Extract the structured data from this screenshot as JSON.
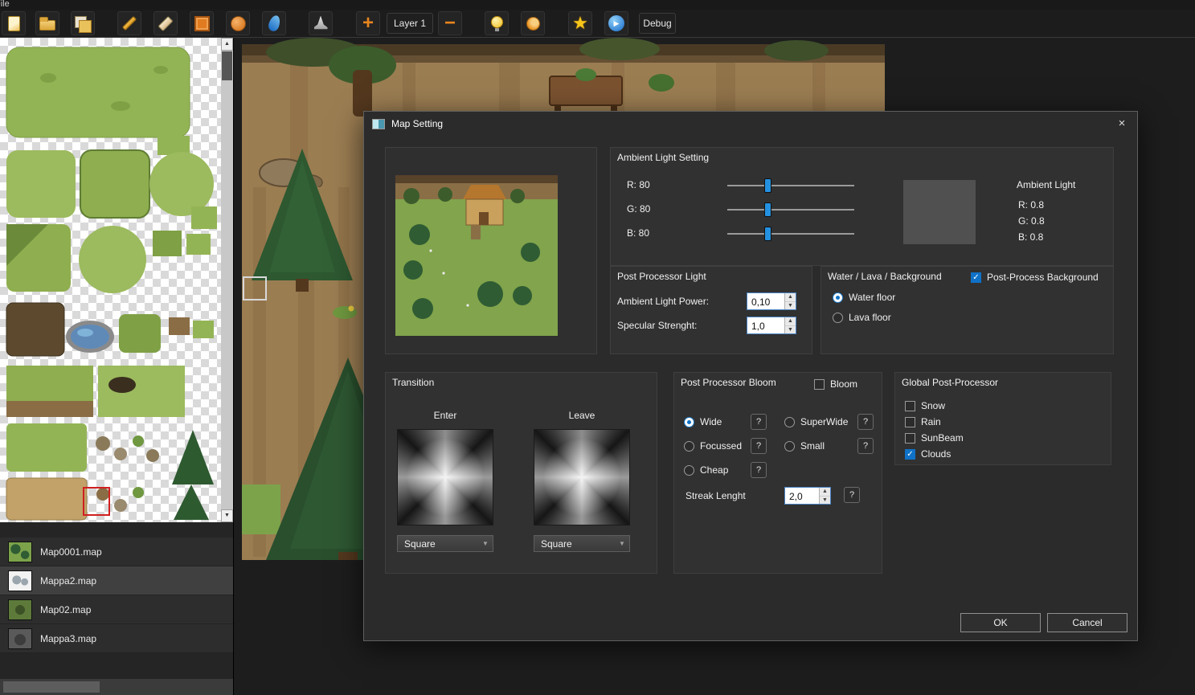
{
  "menu": {
    "file": "File"
  },
  "toolbar": {
    "layer_selector": "Layer 1",
    "debug": "Debug"
  },
  "glyphs": {
    "plus": "+",
    "minus": "−",
    "star": "★",
    "play": "▶",
    "close": "×",
    "question": "?",
    "dropdown_arrow": "▼",
    "spin_up": "▲",
    "spin_down": "▼",
    "scroll_up": "▲",
    "scroll_down": "▼",
    "check": "✓"
  },
  "left_panel": {
    "maps": [
      {
        "name": "Map0001.map",
        "selected": false
      },
      {
        "name": "Mappa2.map",
        "selected": true
      },
      {
        "name": "Map02.map",
        "selected": false
      },
      {
        "name": "Mappa3.map",
        "selected": false
      }
    ]
  },
  "dialog": {
    "title": "Map Setting",
    "ambient_group": {
      "title": "Ambient Light Setting",
      "sliders": [
        {
          "label": "R: 80",
          "value": 80,
          "max": 255
        },
        {
          "label": "G: 80",
          "value": 80,
          "max": 255
        },
        {
          "label": "B: 80",
          "value": 80,
          "max": 255
        }
      ],
      "preview_label": "Ambient Light",
      "preview_values": [
        "R: 0.8",
        "G: 0.8",
        "B: 0.8"
      ],
      "preview_color": "#505050"
    },
    "post_light_group": {
      "title": "Post Processor Light",
      "fields": [
        {
          "label": "Ambient Light Power:",
          "value": "0,10"
        },
        {
          "label": "Specular Strenght:",
          "value": "1,0"
        }
      ]
    },
    "water_group": {
      "title": "Water / Lava / Background",
      "checkbox": {
        "label": "Post-Process Background",
        "checked": true
      },
      "options": [
        {
          "label": "Water floor",
          "selected": true
        },
        {
          "label": "Lava floor",
          "selected": false
        }
      ]
    },
    "transition_group": {
      "title": "Transition",
      "enter_label": "Enter",
      "leave_label": "Leave",
      "enter_value": "Square",
      "leave_value": "Square"
    },
    "bloom_group": {
      "title": "Post Processor Bloom",
      "checkbox": {
        "label": "Bloom",
        "checked": false
      },
      "options": [
        {
          "label": "Wide",
          "selected": true
        },
        {
          "label": "SuperWide",
          "selected": false
        },
        {
          "label": "Focussed",
          "selected": false
        },
        {
          "label": "Small",
          "selected": false
        },
        {
          "label": "Cheap",
          "selected": false
        }
      ],
      "streak_label": "Streak Lenght",
      "streak_value": "2,0"
    },
    "global_group": {
      "title": "Global Post-Processor",
      "options": [
        {
          "label": "Snow",
          "checked": false
        },
        {
          "label": "Rain",
          "checked": false
        },
        {
          "label": "SunBeam",
          "checked": false
        },
        {
          "label": "Clouds",
          "checked": true
        }
      ]
    },
    "ok": "OK",
    "cancel": "Cancel"
  }
}
